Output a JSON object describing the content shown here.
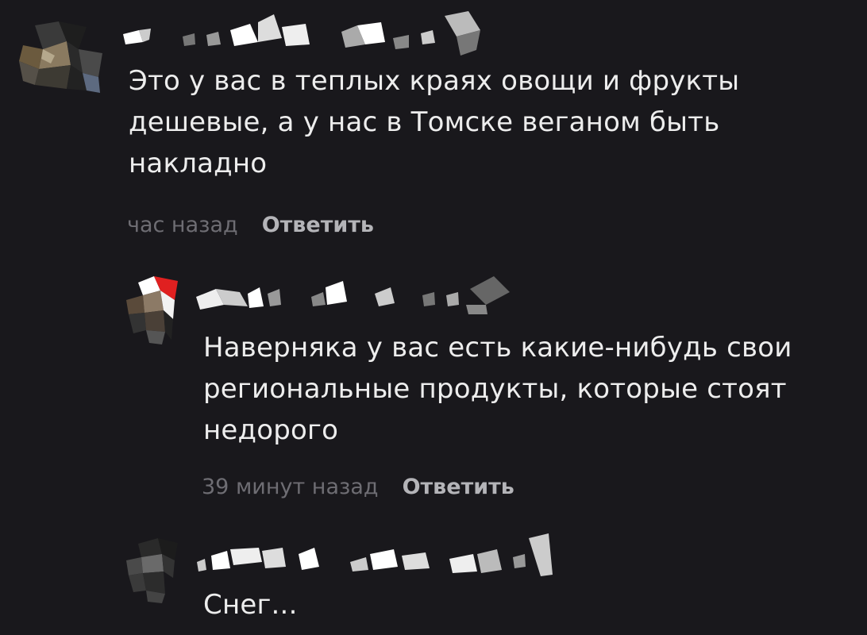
{
  "comments": [
    {
      "text": "Это у вас в теплых краях овощи и фрукты\nдешевые, а у нас в Томске веганом быть\nнакладно",
      "time": "час назад",
      "reply_label": "Ответить"
    },
    {
      "text": "Наверняка у вас есть какие-нибудь свои\nрегиональные продукты, которые стоят\nнедорого",
      "time": "39 минут назад",
      "reply_label": "Ответить"
    },
    {
      "text": "Снег..."
    }
  ]
}
